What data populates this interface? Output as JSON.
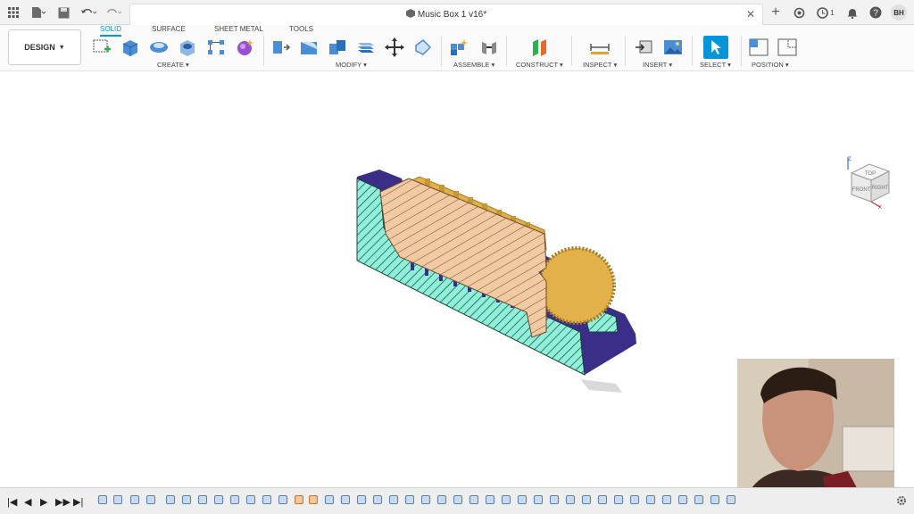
{
  "titlebar": {
    "document_title": "Music Box 1 v16*",
    "job_count": "1",
    "user_initials": "BH"
  },
  "toolbar": {
    "workspace_button": "DESIGN",
    "workspace_tabs": [
      "SOLID",
      "SURFACE",
      "SHEET METAL",
      "TOOLS"
    ],
    "groups": [
      "CREATE",
      "MODIFY",
      "ASSEMBLE",
      "CONSTRUCT",
      "INSPECT",
      "INSERT",
      "SELECT",
      "POSITION"
    ]
  },
  "viewcube": {
    "faces": [
      "TOP",
      "FRONT",
      "RIGHT"
    ],
    "axes": [
      "Z",
      "X"
    ]
  },
  "colors": {
    "accent": "#0696d7",
    "part_body": "#f1c9a2",
    "gear": "#e2b14a",
    "base": "#3a2e88",
    "section_fill": "#8ff0d9"
  },
  "timeline": {
    "controls": [
      "|◀",
      "◀",
      "▶",
      "▶▶",
      "▶|"
    ]
  }
}
